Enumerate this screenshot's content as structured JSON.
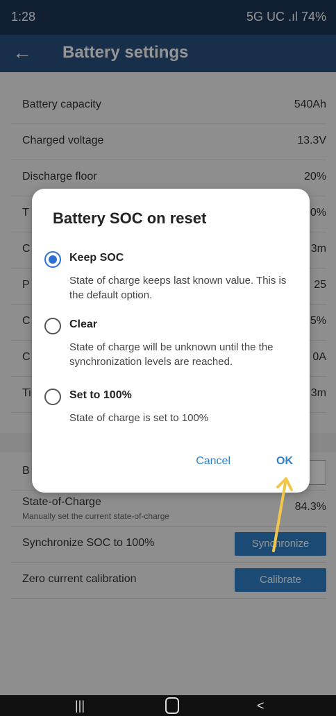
{
  "status": {
    "time": "1:28",
    "right": "5G UC .ıl 74%"
  },
  "appbar": {
    "back_icon": "arrow-left-icon",
    "title": "Battery settings"
  },
  "settings": [
    {
      "label": "Battery capacity",
      "value": "540Ah"
    },
    {
      "label": "Charged voltage",
      "value": "13.3V"
    },
    {
      "label": "Discharge floor",
      "value": "20%"
    },
    {
      "label": "T",
      "value": "0%"
    },
    {
      "label": "C",
      "value": "3m"
    },
    {
      "label": "P",
      "value": "25"
    },
    {
      "label": "C",
      "value": "5%"
    },
    {
      "label": "C",
      "value": "0A"
    },
    {
      "label": "Ti",
      "value": "3m"
    }
  ],
  "lower": {
    "b_label": "B",
    "b_button": "C",
    "soc": {
      "label": "State-of-Charge",
      "sub": "Manually set the current state-of-charge",
      "value": "84.3%"
    },
    "sync": {
      "label": "Synchronize SOC to 100%",
      "button": "Synchronize"
    },
    "zero": {
      "label": "Zero current calibration",
      "button": "Calibrate"
    }
  },
  "dialog": {
    "title": "Battery SOC on reset",
    "options": [
      {
        "label": "Keep SOC",
        "desc": "State of charge keeps last known value. This is the default option.",
        "selected": true
      },
      {
        "label": "Clear",
        "desc": "State of charge will be unknown until the the synchronization levels are reached.",
        "selected": false
      },
      {
        "label": "Set to 100%",
        "desc": "State of charge is set to 100%",
        "selected": false
      }
    ],
    "cancel": "Cancel",
    "ok": "OK"
  },
  "colors": {
    "accent": "#2f80c8",
    "appbar": "#2a5282",
    "arrow": "#f3c64a"
  }
}
